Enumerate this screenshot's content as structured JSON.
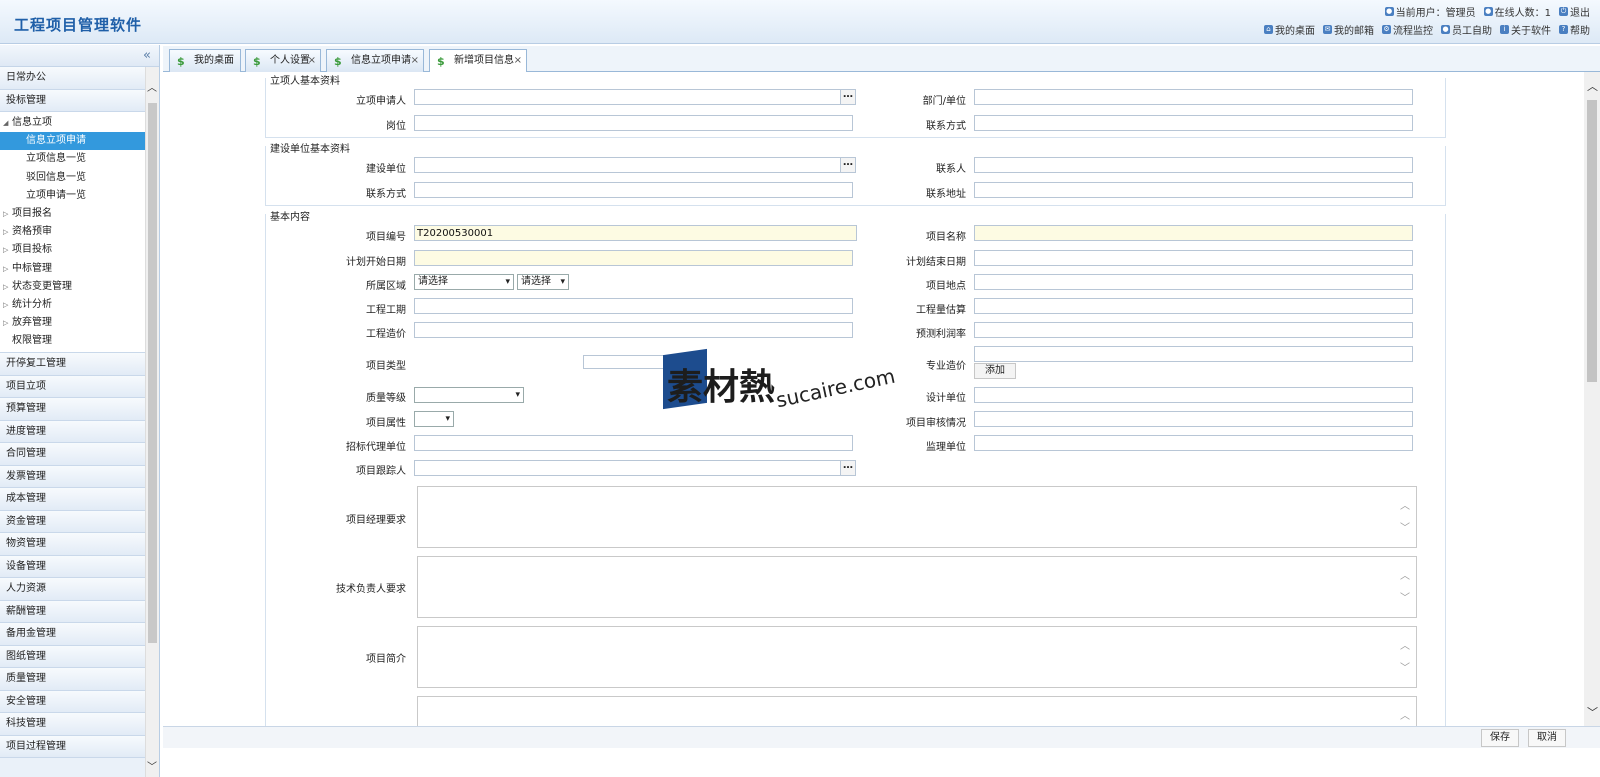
{
  "header": {
    "title": "工程项目管理软件",
    "row1": [
      "当前用户：管理员",
      "在线人数：1",
      "退出"
    ],
    "row2": [
      "我的桌面",
      "我的邮箱",
      "流程监控",
      "员工自助",
      "关于软件",
      "帮助"
    ]
  },
  "sidebar": {
    "collapse_icon": "«",
    "groups_top": [
      "日常办公",
      "投标管理"
    ],
    "tree": {
      "root": "信息立项",
      "children": [
        "信息立项申请",
        "立项信息一览",
        "驳回信息一览",
        "立项申请一览"
      ],
      "siblings": [
        "项目报名",
        "资格预审",
        "项目投标",
        "中标管理",
        "状态变更管理",
        "统计分析",
        "放弃管理"
      ],
      "last": "权限管理"
    },
    "groups_bottom": [
      "开停复工管理",
      "项目立项",
      "预算管理",
      "进度管理",
      "合同管理",
      "发票管理",
      "成本管理",
      "资金管理",
      "物资管理",
      "设备管理",
      "人力资源",
      "薪酬管理",
      "备用金管理",
      "图纸管理",
      "质量管理",
      "安全管理",
      "科技管理",
      "项目过程管理"
    ]
  },
  "tabs": [
    {
      "label": "我的桌面",
      "closable": false
    },
    {
      "label": "个人设置",
      "closable": true
    },
    {
      "label": "信息立项申请",
      "closable": true
    },
    {
      "label": "新增项目信息",
      "closable": true,
      "active": true
    }
  ],
  "form": {
    "sec1_title": "立项人基本资料",
    "sec2_title": "建设单位基本资料",
    "sec3_title": "基本内容",
    "applicant": "立项申请人",
    "dept": "部门/单位",
    "post": "岗位",
    "contact1": "联系方式",
    "build_unit": "建设单位",
    "contact_person": "联系人",
    "contact2": "联系方式",
    "address": "联系地址",
    "project_no": "项目编号",
    "project_no_value": "T20200530001",
    "project_name": "项目名称",
    "plan_start": "计划开始日期",
    "plan_end": "计划结束日期",
    "region": "所属区域",
    "region_sel1": "请选择",
    "region_sel2": "请选择",
    "location": "项目地点",
    "period": "工程工期",
    "quantity": "工程量估算",
    "cost": "工程造价",
    "profit": "预测利润率",
    "project_type": "项目类型",
    "special_cost": "专业造价",
    "add_btn": "添加",
    "quality": "质量等级",
    "design_unit": "设计单位",
    "property": "项目属性",
    "review": "项目审核情况",
    "agency": "招标代理单位",
    "supervisor": "监理单位",
    "tracker": "项目跟踪人",
    "manager_req": "项目经理要求",
    "tech_req": "技术负责人要求",
    "brief": "项目简介"
  },
  "footer": {
    "save": "保存",
    "cancel": "取消"
  },
  "watermark": {
    "cn": "素材熱",
    "en": "sucaire.com"
  }
}
